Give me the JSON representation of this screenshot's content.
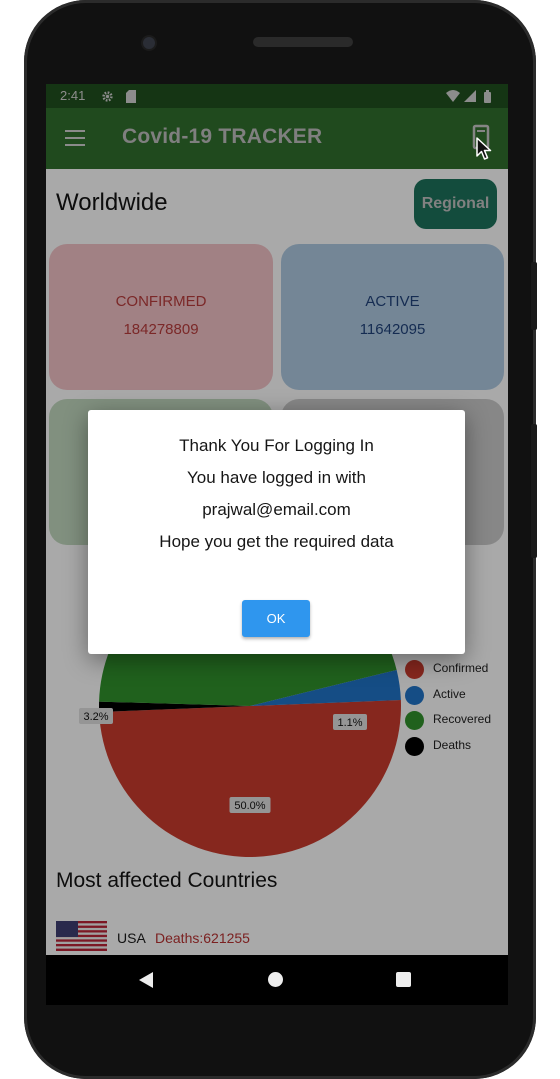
{
  "status_bar": {
    "time": "2:41"
  },
  "app_bar": {
    "title": "Covid-19 TRACKER"
  },
  "header": {
    "title": "Worldwide",
    "regional_label": "Regional"
  },
  "cards": {
    "confirmed": {
      "label": "CONFIRMED",
      "value": "184278809"
    },
    "active": {
      "label": "ACTIVE",
      "value": "11642095"
    }
  },
  "chart_data": {
    "type": "pie",
    "slices": [
      {
        "label": "Confirmed",
        "percent_label": "50.0%",
        "value": 50.0,
        "color": "#c0392b"
      },
      {
        "label": "Active",
        "percent_label": "3.2%",
        "value": 3.2,
        "color": "#1f6fbf"
      },
      {
        "label": "Recovered",
        "value": 45.7,
        "color": "#2e8b2a"
      },
      {
        "label": "Deaths",
        "percent_label": "1.1%",
        "value": 1.1,
        "color": "#000000"
      }
    ],
    "legend_position": "right"
  },
  "legend": {
    "confirmed": "Confirmed",
    "active": "Active",
    "recovered": "Recovered",
    "deaths": "Deaths"
  },
  "countries_section": {
    "title": "Most affected Countries",
    "rows": [
      {
        "country": "USA",
        "deaths": "Deaths:621255"
      }
    ]
  },
  "dialog": {
    "line1": "Thank You For Logging In",
    "line2": "You have logged in with",
    "line3": "prajwal@email.com",
    "line4": "Hope you get the required data",
    "ok_label": "OK"
  },
  "colors": {
    "appbar": "#2e6b2b",
    "regional_button": "#1c6e58",
    "ok_button": "#2f96ee"
  }
}
